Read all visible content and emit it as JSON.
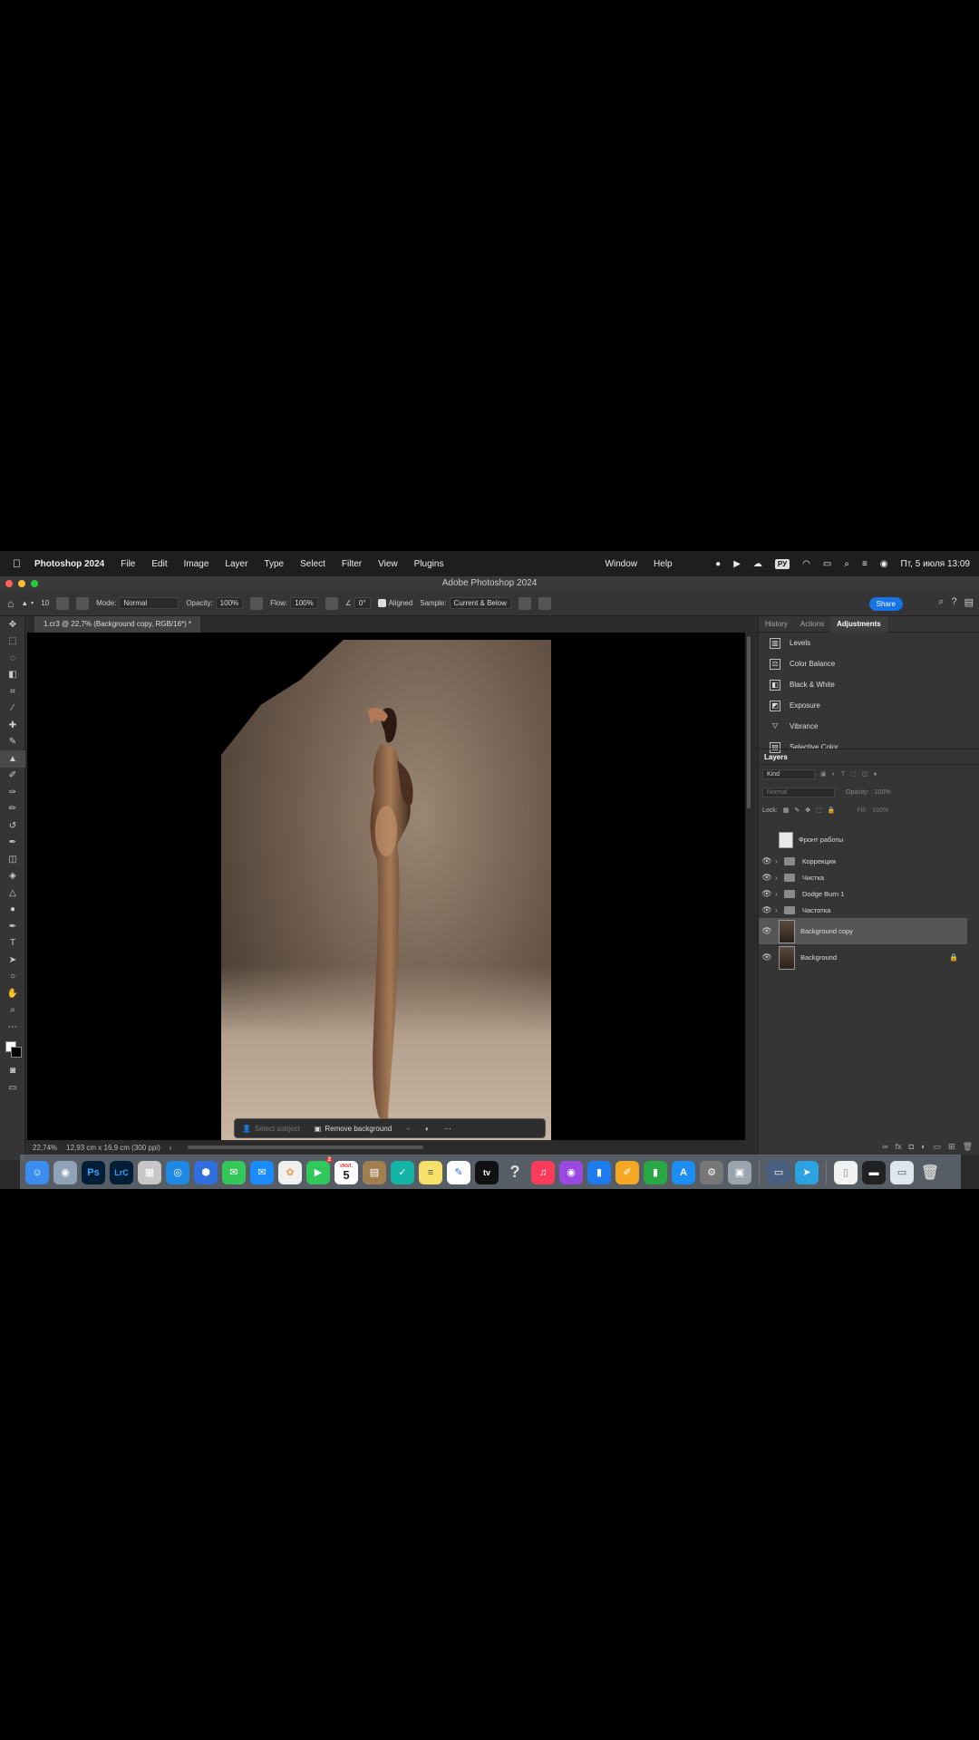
{
  "menubar": {
    "app_name": "Photoshop 2024",
    "items": [
      "File",
      "Edit",
      "Image",
      "Layer",
      "Type",
      "Select",
      "Filter",
      "View",
      "Plugins",
      "Window",
      "Help"
    ],
    "input_source": "РУ",
    "clock": "Пт, 5 июля  13:09"
  },
  "window": {
    "title": "Adobe Photoshop 2024"
  },
  "options": {
    "brush_size": "10",
    "mode_label": "Mode:",
    "mode_value": "Normal",
    "opacity_label": "Opacity:",
    "opacity_value": "100%",
    "flow_label": "Flow:",
    "flow_value": "100%",
    "angle_value": "0°",
    "aligned_label": "Aligned",
    "sample_label": "Sample:",
    "sample_value": "Current & Below",
    "share_label": "Share"
  },
  "document": {
    "tab_title": "1.cr3 @ 22,7% (Background copy, RGB/16*) *",
    "zoom": "22,74%",
    "size_info": "12,93 cm x 16,9 cm (300 ppi)"
  },
  "contextbar": {
    "select_subject": "Select subject",
    "remove_background": "Remove background"
  },
  "panels": {
    "tabs": [
      "History",
      "Actions",
      "Adjustments"
    ],
    "adjustments": [
      "Levels",
      "Color Balance",
      "Black & White",
      "Exposure",
      "Vibrance",
      "Selective Color"
    ],
    "layers_title": "Layers",
    "kind_label": "Kind",
    "blend_mode": "Normal",
    "opacity_label": "Opacity:",
    "opacity_value": "100%",
    "lock_label": "Lock:",
    "fill_label": "Fill:",
    "fill_value": "100%"
  },
  "layers": [
    {
      "name": "Фронт работы",
      "type": "adjustment",
      "visible": false
    },
    {
      "name": "Коррекция",
      "type": "group",
      "visible": true
    },
    {
      "name": "Чистка",
      "type": "group",
      "visible": true
    },
    {
      "name": "Dodge Burn 1",
      "type": "group",
      "visible": true
    },
    {
      "name": "Частотка",
      "type": "group",
      "visible": true
    },
    {
      "name": "Background copy",
      "type": "image",
      "visible": true,
      "selected": true
    },
    {
      "name": "Background",
      "type": "image",
      "visible": true,
      "locked": true
    }
  ],
  "dock": {
    "facetime_badge": "2",
    "calendar_month": "ИЮЛ.",
    "calendar_day": "5"
  },
  "colors": {
    "accent": "#1473e6",
    "panel_bg": "#353535",
    "app_bg": "#2b2b2b"
  }
}
